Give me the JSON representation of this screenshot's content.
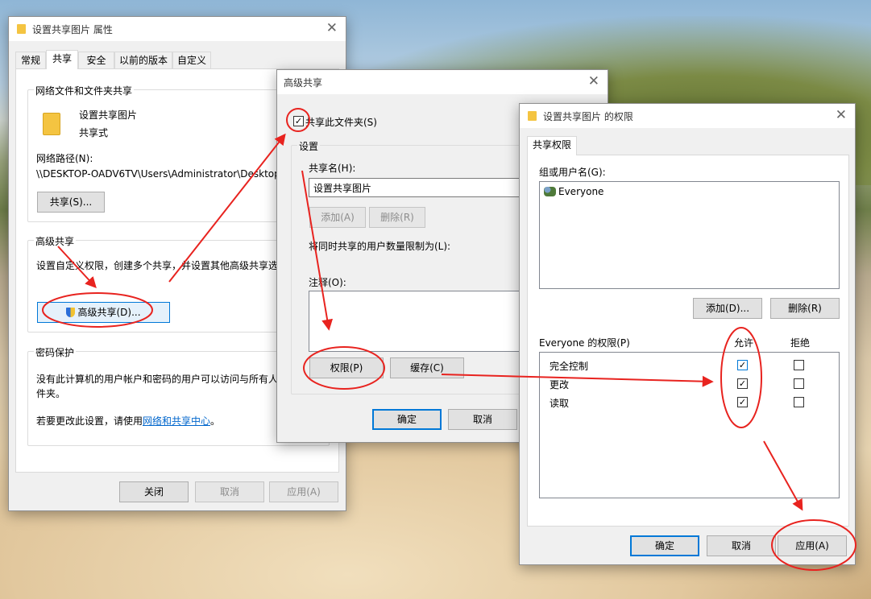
{
  "properties_dialog": {
    "title": "设置共享图片 属性",
    "tabs": [
      "常规",
      "共享",
      "安全",
      "以前的版本",
      "自定义"
    ],
    "network_group": "网络文件和文件夹共享",
    "folder_name": "设置共享图片",
    "share_status": "共享式",
    "network_path_label": "网络路径(N):",
    "network_path": "\\\\DESKTOP-OADV6TV\\Users\\Administrator\\Desktop",
    "share_button": "共享(S)...",
    "advanced_group": "高级共享",
    "advanced_desc": "设置自定义权限，创建多个共享，并设置其他高级共享选",
    "advanced_button": "高级共享(D)...",
    "password_group": "密码保护",
    "password_desc_1": "没有此计算机的用户帐户和密码的用户可以访问与所有人",
    "password_desc_2": "件夹。",
    "change_text": "若要更改此设置，请使用",
    "change_link": "网络和共享中心",
    "change_end": "。",
    "close_button": "关闭",
    "cancel_button": "取消",
    "apply_button": "应用(A)"
  },
  "advanced_dialog": {
    "title": "高级共享",
    "share_checkbox": "共享此文件夹(S)",
    "settings_group": "设置",
    "share_name_label": "共享名(H):",
    "share_name": "设置共享图片",
    "add_button": "添加(A)",
    "remove_button": "删除(R)",
    "limit_label": "将同时共享的用户数量限制为(L):",
    "comment_label": "注释(O):",
    "permissions_button": "权限(P)",
    "cache_button": "缓存(C)",
    "ok_button": "确定",
    "cancel_button": "取消"
  },
  "permissions_dialog": {
    "title": "设置共享图片 的权限",
    "tab": "共享权限",
    "group_label": "组或用户名(G):",
    "users": [
      "Everyone"
    ],
    "add_button": "添加(D)...",
    "remove_button": "删除(R)",
    "perm_label": "Everyone 的权限(P)",
    "allow_header": "允许",
    "deny_header": "拒绝",
    "permissions": [
      {
        "name": "完全控制",
        "allow": "✓",
        "deny": ""
      },
      {
        "name": "更改",
        "allow": "✓",
        "deny": ""
      },
      {
        "name": "读取",
        "allow": "✓",
        "deny": ""
      }
    ],
    "ok_button": "确定",
    "cancel_button": "取消",
    "apply_button": "应用(A)"
  },
  "colors": {
    "annotation": "#e8231f",
    "accent": "#0078d7"
  }
}
